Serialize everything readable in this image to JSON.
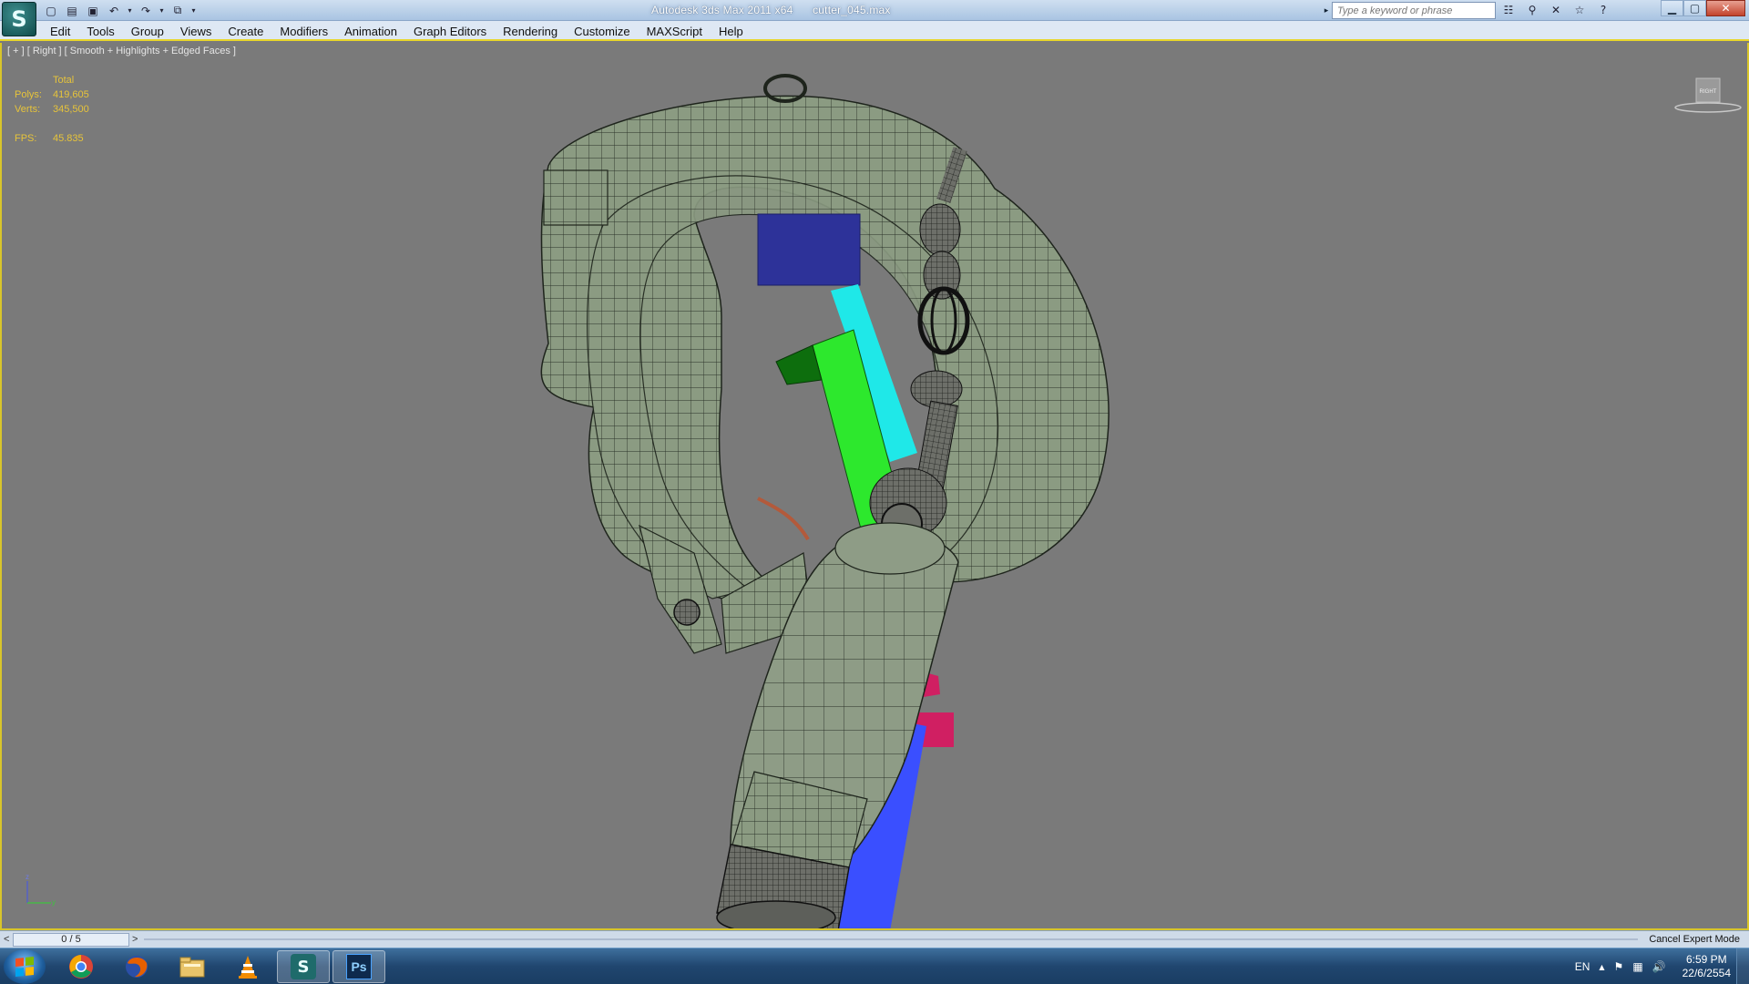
{
  "app": {
    "logo_glyph": "S",
    "title_app": "Autodesk 3ds Max  2011 x64",
    "title_file": "cutter_045.max"
  },
  "quick_access": {
    "new_glyph": "▢",
    "open_glyph": "▤",
    "save_glyph": "▣",
    "undo_glyph": "↶",
    "redo_glyph": "↷",
    "project_glyph": "⧉",
    "dropdown_glyph": "▾"
  },
  "search": {
    "placeholder": "Type a keyword or phrase",
    "arrow_glyph": "▸"
  },
  "info_tools": {
    "binoculars": "☷",
    "key": "⚲",
    "comm": "✕",
    "favorites": "☆",
    "help": "?"
  },
  "window_controls": {
    "minimize": "▁",
    "maximize": "▢",
    "close": "✕"
  },
  "menu": [
    "Edit",
    "Tools",
    "Group",
    "Views",
    "Create",
    "Modifiers",
    "Animation",
    "Graph Editors",
    "Rendering",
    "Customize",
    "MAXScript",
    "Help"
  ],
  "viewport": {
    "label": "[ + ] [ Right ] [ Smooth + Highlights + Edged Faces ]",
    "stats": {
      "header": "Total",
      "polys_label": "Polys:",
      "polys_value": "419,605",
      "verts_label": "Verts:",
      "verts_value": "345,500",
      "fps_label": "FPS:",
      "fps_value": "45.835"
    },
    "viewcube_label": "RIGHT",
    "axis": {
      "z": "z",
      "y": "y"
    }
  },
  "timeline": {
    "frame_text": "0 / 5",
    "left_arrow": "<",
    "right_arrow": ">",
    "cancel_expert": "Cancel Expert Mode"
  },
  "taskbar": {
    "items": [
      "Chrome",
      "Firefox",
      "Explorer",
      "VLC",
      "3ds Max",
      "Photoshop"
    ],
    "photoshop_label": "Ps",
    "max_label": "S",
    "tray_lang": "EN",
    "tray_up": "▲",
    "tray_flag": "⚑",
    "tray_net": "▦",
    "tray_vol": "🔊",
    "time": "6:59 PM",
    "date": "22/6/2554"
  },
  "colors": {
    "viewport_bg": "#7a7a7a",
    "stats_text": "#e7c43a",
    "mesh_fill": "#8a9a80",
    "accent_border": "#d8c52a"
  }
}
